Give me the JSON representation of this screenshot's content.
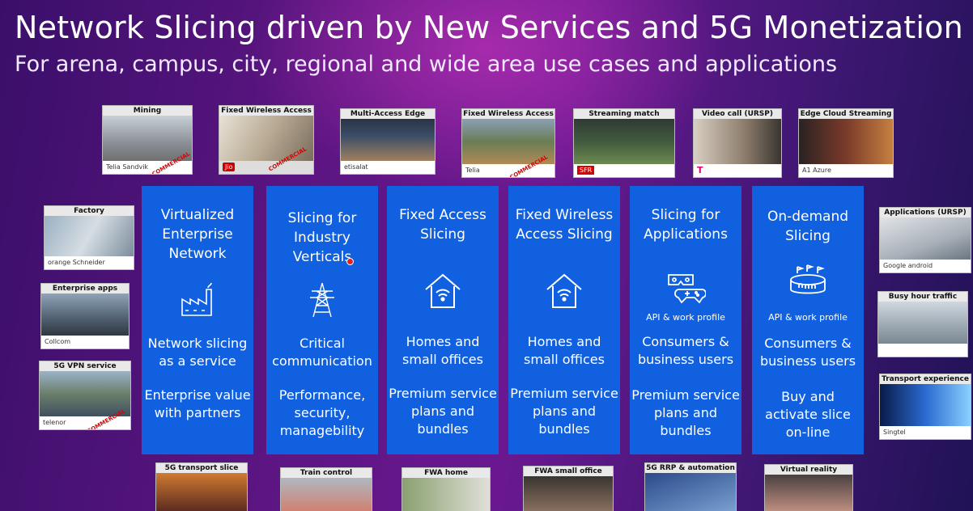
{
  "slide": {
    "title": "Network Slicing driven by New Services and 5G Monetization",
    "subtitle": "For arena, campus, city, regional and wide area use cases and applications"
  },
  "top_thumbs": [
    {
      "label": "Mining",
      "logo": "Telia  Sandvik"
    },
    {
      "label": "Fixed Wireless Access",
      "logo": "Jio"
    },
    {
      "label": "Multi-Access Edge",
      "logo": "etisalat"
    },
    {
      "label": "Fixed Wireless Access",
      "logo": "Telia"
    },
    {
      "label": "Streaming match",
      "logo": "SFR"
    },
    {
      "label": "Video call (URSP)",
      "logo": "T"
    },
    {
      "label": "Edge Cloud Streaming",
      "logo": "A1  Azure"
    }
  ],
  "left_thumbs": [
    {
      "label": "Factory",
      "logo": "orange   Schneider"
    },
    {
      "label": "Enterprise apps",
      "logo": "Collcom"
    },
    {
      "label": "5G VPN service",
      "logo": "telenor"
    }
  ],
  "right_thumbs": [
    {
      "label": "Applications (URSP)",
      "logo": "Google android"
    },
    {
      "label": "Busy hour traffic",
      "logo": ""
    },
    {
      "label": "Transport experience",
      "logo": "Singtel"
    }
  ],
  "bottom_thumbs": [
    {
      "label": "5G transport slice"
    },
    {
      "label": "Train control"
    },
    {
      "label": "FWA home"
    },
    {
      "label": "FWA small office"
    },
    {
      "label": "5G RRP & automation"
    },
    {
      "label": "Virtual reality"
    }
  ],
  "stamp_text": "COMMERCIAL",
  "columns": [
    {
      "heading": "Virtualized Enterprise Network",
      "icon": "factory-icon",
      "api": "",
      "line1": "Network slicing as a service",
      "line2": "Enterprise value with partners"
    },
    {
      "heading": "Slicing for Industry Verticals",
      "icon": "power-tower-icon",
      "api": "",
      "line1": "Critical communication",
      "line2": "Performance, security, managebility"
    },
    {
      "heading": "Fixed Access Slicing",
      "icon": "home-wifi-icon",
      "api": "",
      "line1": "Homes and small offices",
      "line2": "Premium service plans and bundles"
    },
    {
      "heading": "Fixed Wireless Access Slicing",
      "icon": "home-wifi-icon",
      "api": "",
      "line1": "Homes and small offices",
      "line2": "Premium service plans and bundles"
    },
    {
      "heading": "Slicing for Applications",
      "icon": "vr-gamepad-icon",
      "api": "API & work profile",
      "line1": "Consumers & business users",
      "line2": "Premium service plans and bundles"
    },
    {
      "heading": "On-demand Slicing",
      "icon": "stadium-icon",
      "api": "API & work profile",
      "line1": "Consumers & business users",
      "line2": "Buy and activate slice on-line"
    }
  ],
  "colors": {
    "column_blue": "#1060e0",
    "bg_purple": "#5a1580",
    "stamp_red": "#d00000"
  }
}
